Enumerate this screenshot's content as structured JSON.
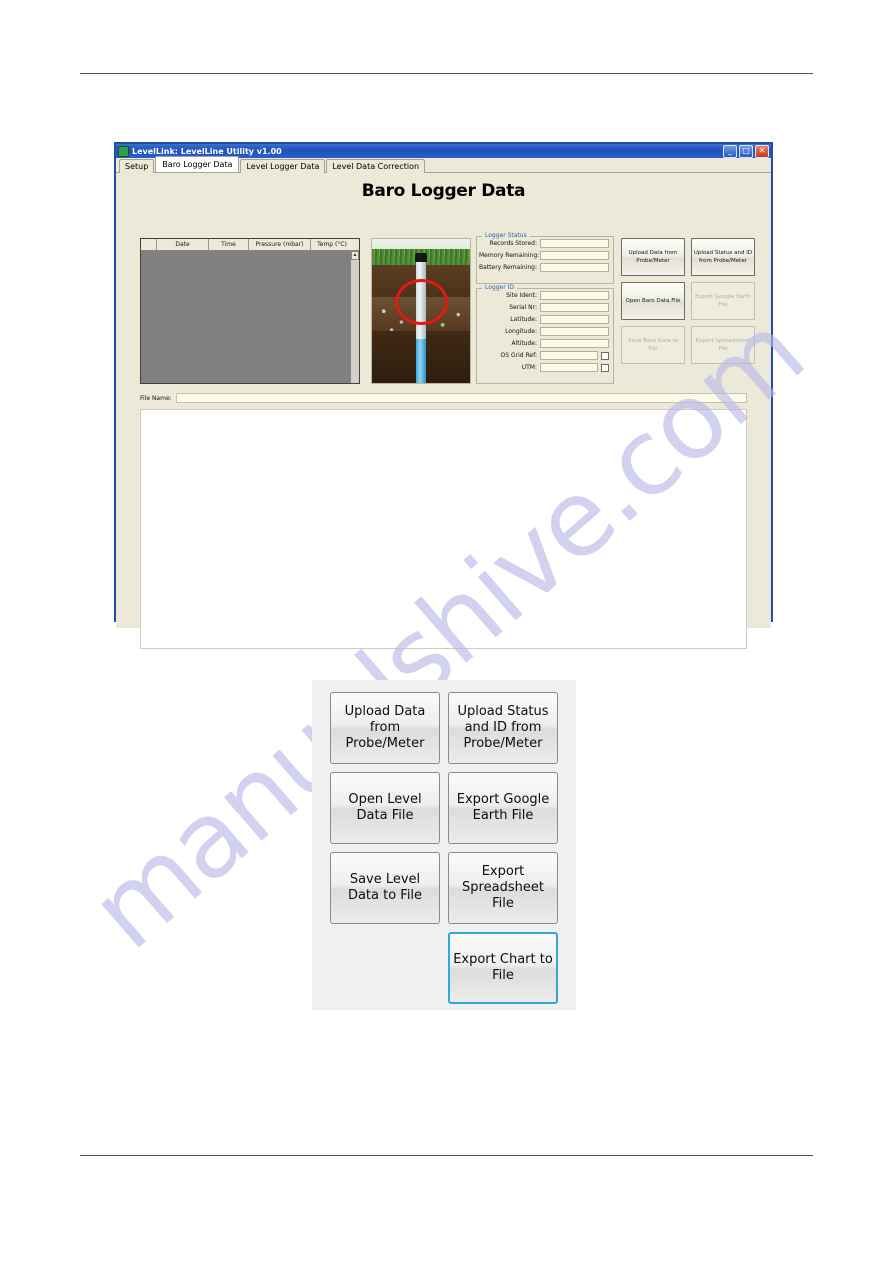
{
  "watermark": {
    "text": "manualshive.com"
  },
  "window": {
    "title": "LevelLink: LevelLine Utility v1.00",
    "title_icon": "app-icon",
    "controls": {
      "minimize": "_",
      "maximize": "□",
      "close": "✕"
    },
    "tabs": [
      {
        "label": "Setup",
        "active": false
      },
      {
        "label": "Baro Logger Data",
        "active": true
      },
      {
        "label": "Level Logger Data",
        "active": false
      },
      {
        "label": "Level Data Correction",
        "active": false
      }
    ],
    "page_title": "Baro Logger Data",
    "grid": {
      "columns": [
        "",
        "Date",
        "Time",
        "Pressure (mbar)",
        "Temp (°C)"
      ],
      "rows": []
    },
    "illustration": {
      "name": "soil-profile-with-probe",
      "annotation": "red-circle-highlight"
    },
    "logger_status": {
      "title": "Logger Status",
      "fields": [
        {
          "label": "Records Stored:",
          "value": ""
        },
        {
          "label": "Memory Remaining:",
          "value": ""
        },
        {
          "label": "Battery Remaining:",
          "value": ""
        }
      ]
    },
    "logger_id": {
      "title": "Logger ID",
      "fields": [
        {
          "label": "Site Ident:",
          "value": "",
          "checkbox": false
        },
        {
          "label": "Serial Nr:",
          "value": "",
          "checkbox": false
        },
        {
          "label": "Latitude:",
          "value": "",
          "checkbox": false
        },
        {
          "label": "Longitude:",
          "value": "",
          "checkbox": false
        },
        {
          "label": "Altitude:",
          "value": "",
          "checkbox": false
        },
        {
          "label": "OS Grid Ref:",
          "value": "",
          "checkbox": true
        },
        {
          "label": "UTM:",
          "value": "",
          "checkbox": true
        }
      ]
    },
    "action_buttons": [
      {
        "label": "Upload Data from Probe/Meter",
        "enabled": true
      },
      {
        "label": "Upload Status and ID from Probe/Meter",
        "enabled": true
      },
      {
        "label": "Open Baro Data File",
        "enabled": true
      },
      {
        "label": "Export Google Earth File",
        "enabled": false
      },
      {
        "label": "Save Baro Data to File",
        "enabled": false
      },
      {
        "label": "Export Spreadsheet File",
        "enabled": false
      }
    ],
    "file_name": {
      "label": "File Name:",
      "value": ""
    }
  },
  "callout": {
    "buttons": [
      {
        "label": "Upload Data from Probe/Meter",
        "highlight": false
      },
      {
        "label": "Upload Status and ID from Probe/Meter",
        "highlight": false
      },
      {
        "label": "Open Level Data File",
        "highlight": false
      },
      {
        "label": "Export Google Earth File",
        "highlight": false
      },
      {
        "label": "Save Level Data to File",
        "highlight": false
      },
      {
        "label": "Export Spreadsheet File",
        "highlight": false
      },
      {
        "label": "",
        "highlight": false
      },
      {
        "label": "Export Chart to File",
        "highlight": true
      }
    ]
  },
  "colors": {
    "title_bar": "#1e51bb",
    "window_face": "#ece9d8",
    "grid_body": "#808080",
    "group_title": "#2a5fb4",
    "highlight_border": "#33a8d8",
    "annotation_red": "#e01b12",
    "watermark": "#b8b8e8"
  }
}
